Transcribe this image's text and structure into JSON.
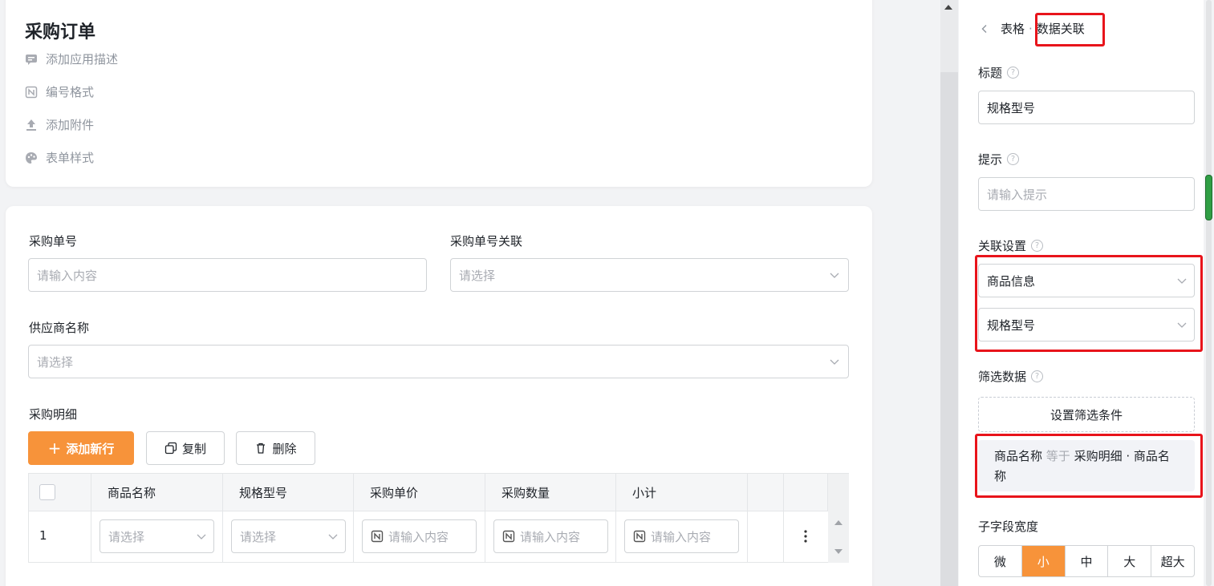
{
  "app": {
    "title": "采购订单",
    "meta": [
      "添加应用描述",
      "编号格式",
      "添加附件",
      "表单样式"
    ]
  },
  "form": {
    "po_number": {
      "label": "采购单号",
      "placeholder": "请输入内容"
    },
    "po_link": {
      "label": "采购单号关联",
      "placeholder": "请选择"
    },
    "supplier": {
      "label": "供应商名称",
      "placeholder": "请选择"
    },
    "detail": {
      "label": "采购明细",
      "buttons": {
        "add": "添加新行",
        "copy": "复制",
        "delete": "删除"
      },
      "columns": [
        "商品名称",
        "规格型号",
        "采购单价",
        "采购数量",
        "小计"
      ],
      "row": {
        "index": "1",
        "select_placeholder": "请选择",
        "input_placeholder": "请输入内容"
      }
    }
  },
  "panel": {
    "breadcrumb": {
      "parent": "表格",
      "separator": "·",
      "current": "数据关联"
    },
    "title_label": "标题",
    "title_value": "规格型号",
    "hint_label": "提示",
    "hint_placeholder": "请输入提示",
    "relation_label": "关联设置",
    "relation_form": "商品信息",
    "relation_field": "规格型号",
    "filter_label": "筛选数据",
    "filter_button": "设置筛选条件",
    "filter_condition": {
      "field": "商品名称",
      "op": "等于",
      "value": "采购明细 · 商品名称"
    },
    "width_label": "子字段宽度",
    "width_options": [
      "微",
      "小",
      "中",
      "大",
      "超大"
    ],
    "width_selected": "小"
  },
  "colors": {
    "accent": "#f7933a",
    "highlight": "#e8141b"
  }
}
